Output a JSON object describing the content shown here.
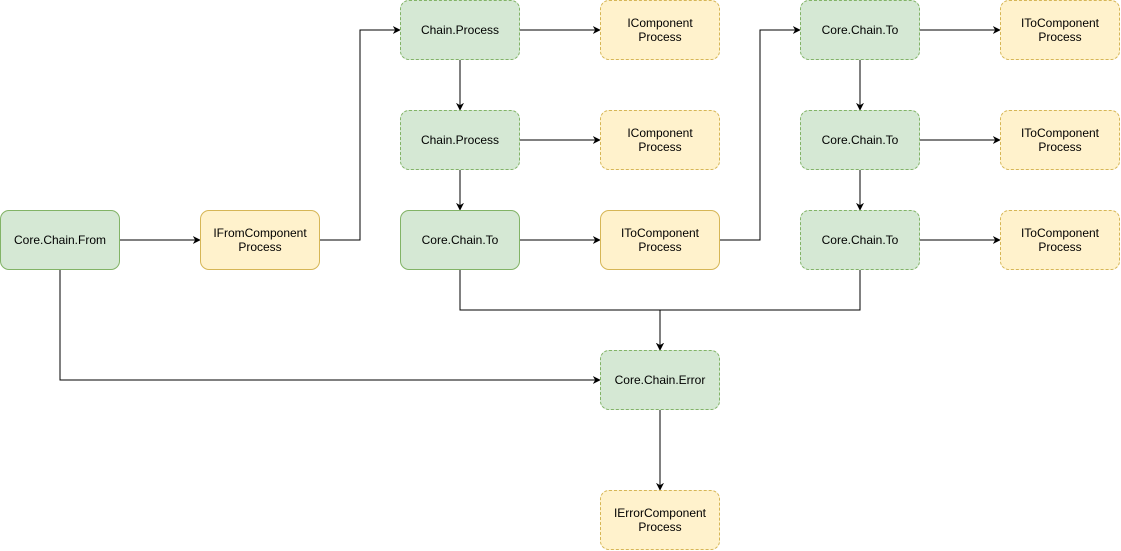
{
  "diagram": {
    "colors": {
      "process_fill": "#d5e8d4",
      "process_stroke": "#82b366",
      "component_fill": "#fff2cc",
      "component_stroke": "#d6b656",
      "edge": "#000000"
    },
    "nodes": [
      {
        "id": "from",
        "label": "Core.Chain.From",
        "kind": "process",
        "dashed": false
      },
      {
        "id": "from_comp",
        "label": "IFromComponent\nProcess",
        "kind": "component",
        "dashed": false
      },
      {
        "id": "process1",
        "label": "Chain.Process",
        "kind": "process",
        "dashed": true
      },
      {
        "id": "process1_comp",
        "label": "IComponent\nProcess",
        "kind": "component",
        "dashed": true
      },
      {
        "id": "process2",
        "label": "Chain.Process",
        "kind": "process",
        "dashed": true
      },
      {
        "id": "process2_comp",
        "label": "IComponent\nProcess",
        "kind": "component",
        "dashed": true
      },
      {
        "id": "to1",
        "label": "Core.Chain.To",
        "kind": "process",
        "dashed": false
      },
      {
        "id": "to1_comp",
        "label": "IToComponent\nProcess",
        "kind": "component",
        "dashed": false
      },
      {
        "id": "to2",
        "label": "Core.Chain.To",
        "kind": "process",
        "dashed": true
      },
      {
        "id": "to2_comp",
        "label": "IToComponent\nProcess",
        "kind": "component",
        "dashed": true
      },
      {
        "id": "to3",
        "label": "Core.Chain.To",
        "kind": "process",
        "dashed": true
      },
      {
        "id": "to3_comp",
        "label": "IToComponent\nProcess",
        "kind": "component",
        "dashed": true
      },
      {
        "id": "to4",
        "label": "Core.Chain.To",
        "kind": "process",
        "dashed": true
      },
      {
        "id": "to4_comp",
        "label": "IToComponent\nProcess",
        "kind": "component",
        "dashed": true
      },
      {
        "id": "error",
        "label": "Core.Chain.Error",
        "kind": "process",
        "dashed": true
      },
      {
        "id": "error_comp",
        "label": "IErrorComponent\nProcess",
        "kind": "component",
        "dashed": true
      }
    ],
    "edges": [
      {
        "from": "from",
        "to": "from_comp"
      },
      {
        "from": "from_comp",
        "to": "process1"
      },
      {
        "from": "process1",
        "to": "process1_comp"
      },
      {
        "from": "process1",
        "to": "process2"
      },
      {
        "from": "process2",
        "to": "process2_comp"
      },
      {
        "from": "process2",
        "to": "to1"
      },
      {
        "from": "to1",
        "to": "to1_comp"
      },
      {
        "from": "to1_comp",
        "to": "to2"
      },
      {
        "from": "to2",
        "to": "to2_comp"
      },
      {
        "from": "to2",
        "to": "to3"
      },
      {
        "from": "to3",
        "to": "to3_comp"
      },
      {
        "from": "to3",
        "to": "to4"
      },
      {
        "from": "to4",
        "to": "to4_comp"
      },
      {
        "from": "to1",
        "to": "error"
      },
      {
        "from": "to4",
        "to": "error"
      },
      {
        "from": "from",
        "to": "error"
      },
      {
        "from": "error",
        "to": "error_comp"
      }
    ]
  }
}
